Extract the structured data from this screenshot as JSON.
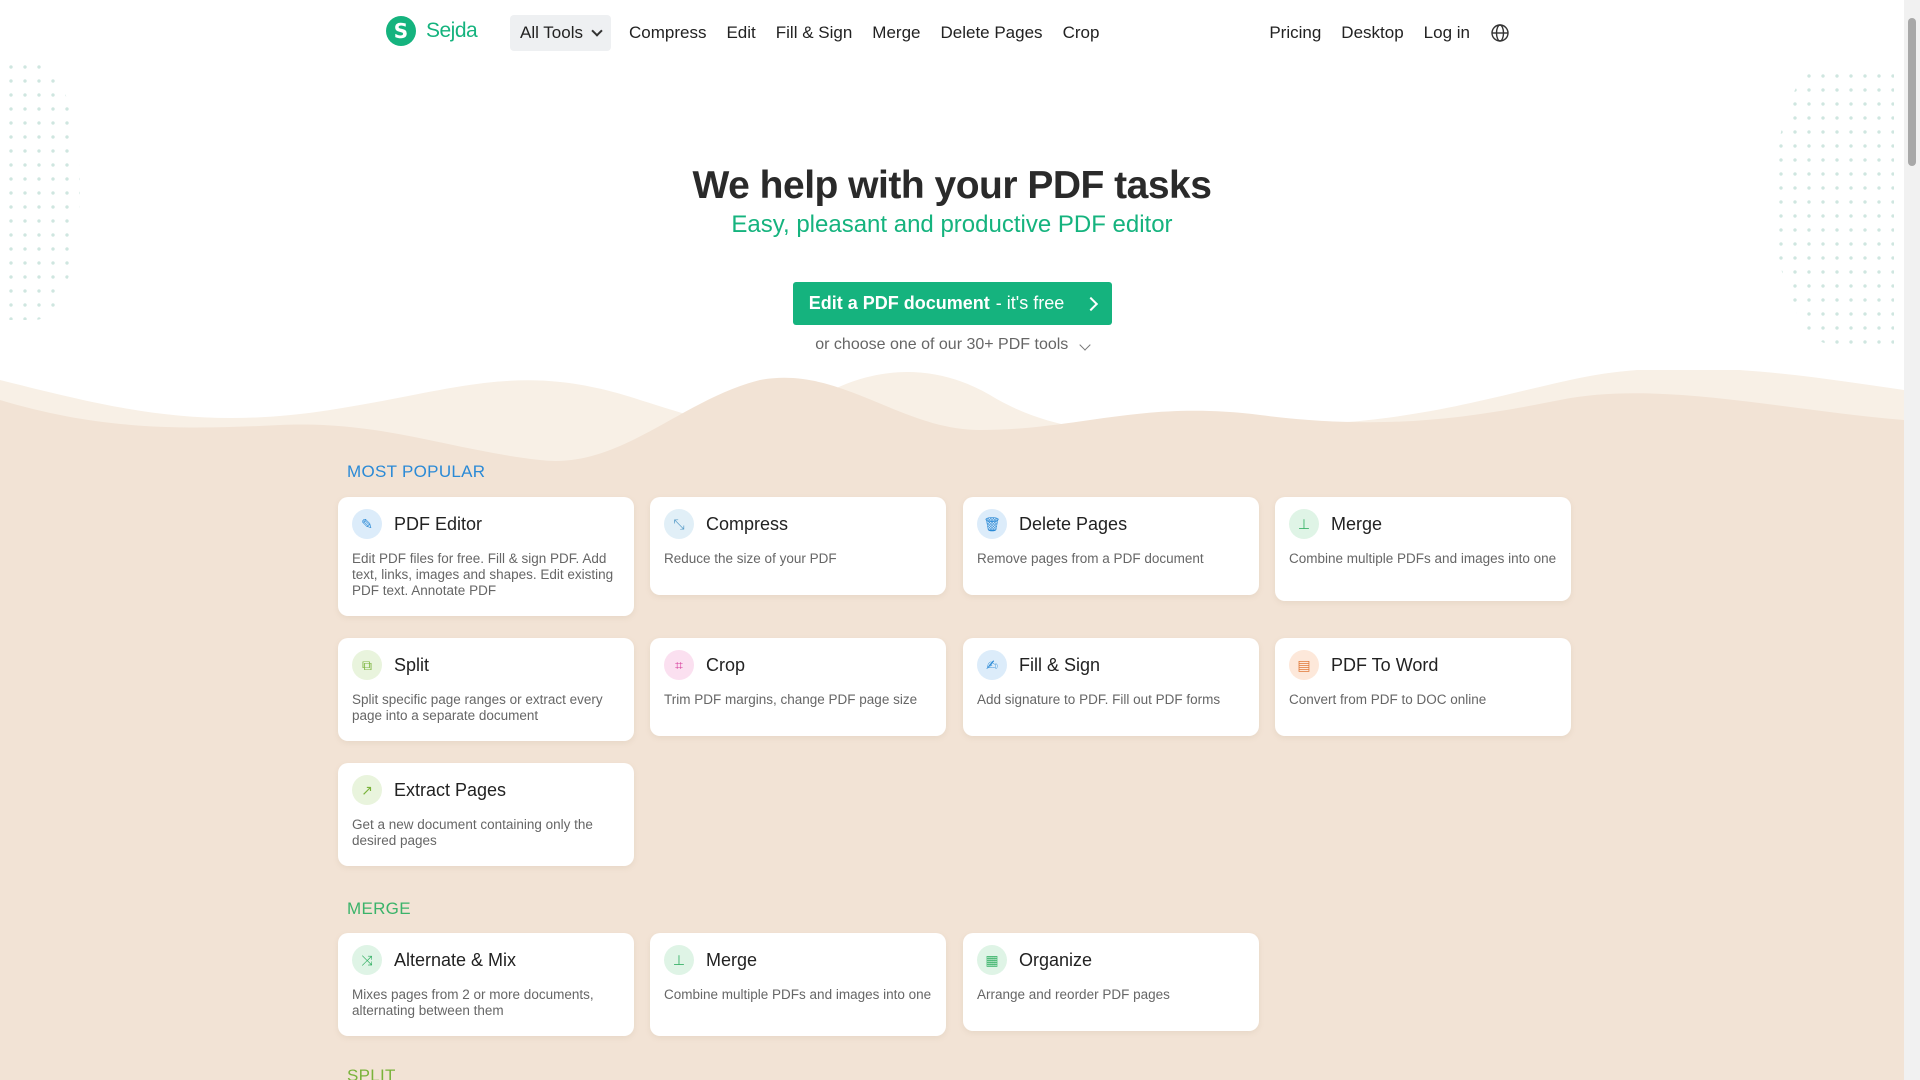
{
  "header": {
    "logo_text": "Sejda",
    "all_tools_label": "All Tools",
    "nav_left": [
      "Compress",
      "Edit",
      "Fill & Sign",
      "Merge",
      "Delete Pages",
      "Crop"
    ],
    "nav_right": [
      "Pricing",
      "Desktop",
      "Log in"
    ],
    "language_icon": "globe-icon"
  },
  "hero": {
    "title": "We help with your PDF tasks",
    "subtitle": "Easy, pleasant and productive PDF editor",
    "cta_bold": "Edit a PDF document",
    "cta_rest": " - it's free",
    "choose_text": "or choose one of our 30+ PDF tools"
  },
  "colors": {
    "brand": "#15b37e",
    "popular_title": "#2b8ad6",
    "merge_title": "#3bb36a",
    "split_title": "#7ab33b"
  },
  "sections": {
    "popular": {
      "title": "MOST POPULAR",
      "cards": [
        {
          "title": "PDF Editor",
          "desc": "Edit PDF files for free. Fill & sign PDF. Add text, links, images and shapes. Edit existing PDF text. Annotate PDF",
          "icon": "pencil-icon"
        },
        {
          "title": "Compress",
          "desc": "Reduce the size of your PDF",
          "icon": "compress-icon"
        },
        {
          "title": "Delete Pages",
          "desc": "Remove pages from a PDF document",
          "icon": "trash-icon"
        },
        {
          "title": "Merge",
          "desc": "Combine multiple PDFs and images into one",
          "icon": "merge-icon"
        },
        {
          "title": "Split",
          "desc": "Split specific page ranges or extract every page into a separate document",
          "icon": "split-icon"
        },
        {
          "title": "Crop",
          "desc": "Trim PDF margins, change PDF page size",
          "icon": "crop-icon"
        },
        {
          "title": "Fill & Sign",
          "desc": "Add signature to PDF. Fill out PDF forms",
          "icon": "signature-icon"
        },
        {
          "title": "PDF To Word",
          "desc": "Convert from PDF to DOC online",
          "icon": "word-doc-icon"
        },
        {
          "title": "Extract Pages",
          "desc": "Get a new document containing only the desired pages",
          "icon": "extract-icon"
        }
      ]
    },
    "merge": {
      "title": "MERGE",
      "cards": [
        {
          "title": "Alternate & Mix",
          "desc": "Mixes pages from 2 or more documents, alternating between them",
          "icon": "shuffle-icon"
        },
        {
          "title": "Merge",
          "desc": "Combine multiple PDFs and images into one",
          "icon": "merge-icon"
        },
        {
          "title": "Organize",
          "desc": "Arrange and reorder PDF pages",
          "icon": "organize-icon"
        }
      ]
    },
    "split": {
      "title": "SPLIT"
    }
  }
}
